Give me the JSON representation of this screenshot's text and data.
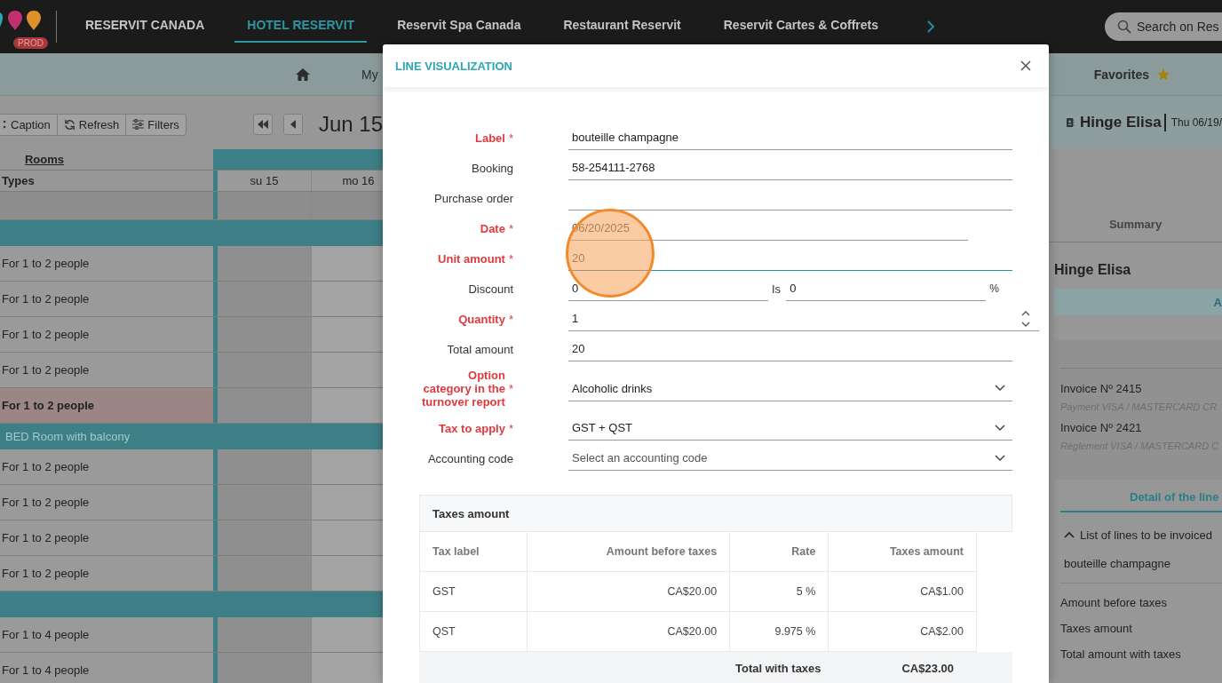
{
  "top_nav": {
    "badge": "PROD",
    "tabs": [
      {
        "label": "RESERVIT CANADA",
        "selected": false
      },
      {
        "label": "HOTEL RESERVIT",
        "selected": true
      },
      {
        "label": "Reservit Spa Canada",
        "selected": false
      },
      {
        "label": "Restaurant Reservit",
        "selected": false
      },
      {
        "label": "Reservit Cartes & Coffrets",
        "selected": false
      }
    ],
    "search": {
      "placeholder": "Search on Res"
    }
  },
  "sub_nav": {
    "menu_label": "My",
    "favorites": "Favorites"
  },
  "toolbar": {
    "buttons": [
      {
        "label": "Caption",
        "kind": "caption"
      },
      {
        "label": "Refresh",
        "kind": "refresh"
      },
      {
        "label": "Filters",
        "kind": "filters"
      }
    ],
    "date": "Jun 15"
  },
  "planning": {
    "rooms_header": "Rooms",
    "types_header": "Types",
    "days": [
      "su 15",
      "mo 16"
    ],
    "rows": [
      {
        "kind": "blank"
      },
      {
        "kind": "category"
      },
      {
        "kind": "room",
        "label": "For 1 to 2 people",
        "highlighted": false
      },
      {
        "kind": "room",
        "label": "For 1 to 2 people",
        "highlighted": false
      },
      {
        "kind": "room",
        "label": "For 1 to 2 people",
        "highlighted": false
      },
      {
        "kind": "room",
        "label": "For 1 to 2 people",
        "highlighted": false
      },
      {
        "kind": "room",
        "label": "For 1 to 2 people",
        "highlighted": true
      },
      {
        "kind": "category",
        "label": "BED Room with balcony"
      },
      {
        "kind": "room",
        "label": "For 1 to 2 people",
        "highlighted": false
      },
      {
        "kind": "room",
        "label": "For 1 to 2 people",
        "highlighted": false
      },
      {
        "kind": "room",
        "label": "For 1 to 2 people",
        "highlighted": false
      },
      {
        "kind": "room",
        "label": "For 1 to 2 people",
        "highlighted": false
      },
      {
        "kind": "category"
      },
      {
        "kind": "room",
        "label": "For 1 to 4 people",
        "highlighted": false
      },
      {
        "kind": "room",
        "label": "For 1 to 4 people",
        "highlighted": false
      }
    ]
  },
  "customer_panel": {
    "name": "Hinge Elisa",
    "date": "Thu 06/19/",
    "tab": "Summary",
    "title": "Hinge Elisa",
    "banner": "A",
    "invoices": [
      {
        "title": "Invoice Nº 2415",
        "payment": "Payment VISA / MASTERCARD CR"
      },
      {
        "title": "Invoice Nº 2421",
        "payment": "Règlement VISA / MASTERCARD C"
      }
    ],
    "detail_tab": "Detail of the line",
    "lines_section": {
      "title": "List of lines to be invoiced",
      "expanded": true,
      "items": [
        "bouteille champagne"
      ]
    },
    "totals": [
      "Amount before taxes",
      "Taxes amount",
      "Total amount with taxes"
    ]
  },
  "dialog": {
    "title": "LINE VISUALIZATION",
    "required_mark": "*",
    "fields": [
      {
        "label": "Label",
        "required": true,
        "kind": "text",
        "value": "bouteille champagne"
      },
      {
        "label": "Booking",
        "required": false,
        "kind": "text",
        "value": "58-254111-2768"
      },
      {
        "label": "Purchase order",
        "required": false,
        "kind": "text"
      },
      {
        "label": "Date",
        "required": true,
        "kind": "date",
        "value": "06/20/2025"
      },
      {
        "label": "Unit amount",
        "required": true,
        "kind": "text",
        "value": "20",
        "focused": true
      },
      {
        "label": "Discount",
        "required": false,
        "kind": "discount",
        "value": "0",
        "separator": "Is",
        "value2": "0",
        "unit": "%"
      },
      {
        "label": "Quantity",
        "required": true,
        "kind": "number",
        "value": "1"
      },
      {
        "label": "Total amount",
        "required": false,
        "kind": "text",
        "value": "20"
      },
      {
        "label": "Option category in the turnover report",
        "required": true,
        "kind": "select",
        "value": "Alcoholic drinks"
      },
      {
        "label": "Tax to apply",
        "required": true,
        "kind": "select",
        "value": "GST + QST"
      },
      {
        "label": "Accounting code",
        "required": false,
        "kind": "select",
        "placeholder": "Select an accounting code"
      }
    ],
    "taxes": {
      "title": "Taxes amount",
      "columns": [
        "Tax label",
        "Amount before taxes",
        "Rate",
        "Taxes amount"
      ],
      "rows": [
        [
          "GST",
          "CA$20.00",
          "5 %",
          "CA$1.00"
        ],
        [
          "QST",
          "CA$20.00",
          "9.975 %",
          "CA$2.00"
        ]
      ],
      "total_label": "Total with taxes",
      "total": "CA$23.00"
    }
  }
}
